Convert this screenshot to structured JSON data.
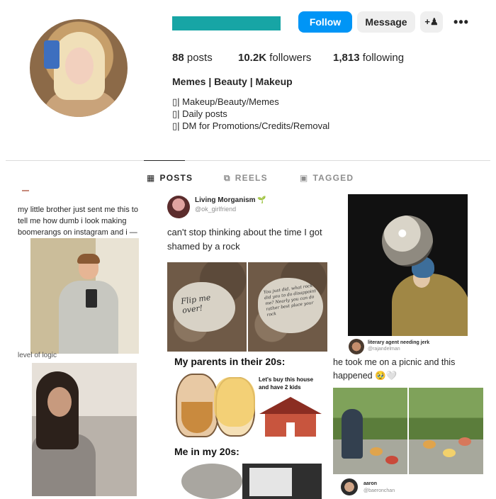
{
  "header": {
    "follow_label": "Follow",
    "message_label": "Message",
    "add_user_icon": "+ᴀ",
    "more_icon": "•••",
    "brand_color": "#0095f6",
    "redaction_color": "#17a5a5"
  },
  "stats": {
    "posts_count": "88",
    "posts_label": "posts",
    "followers_count": "10.2K",
    "followers_label": "followers",
    "following_count": "1,813",
    "following_label": "following"
  },
  "bio": {
    "name": "Memes | Beauty | Makeup",
    "lines": [
      "▯| Makeup/Beauty/Memes",
      "▯| Daily posts",
      "▯| DM for Promotions/Credits/Removal"
    ]
  },
  "tabs": {
    "posts": "POSTS",
    "reels": "REELS",
    "tagged": "TAGGED",
    "posts_icon": "▦",
    "reels_icon": "⧉",
    "tagged_icon": "▣"
  },
  "grid": {
    "post1": {
      "text": "my little brother just sent me this to tell me how dumb i look making boomerangs on instagram and i —",
      "caption": "level of logic"
    },
    "post2": {
      "account_name": "Living Morganism",
      "sprout_icon": "🌱",
      "account_handle": "@ok_girlfriend",
      "tweet": "can't stop thinking about the time I got shamed by a rock",
      "rock_left_text": "Flip me over!",
      "rock_right_text": "You just did, what rock did you to do disappoint me? Nearly you can do rather best place your rock",
      "heading_20s_parents": "My parents in their 20s:",
      "sub_text": "Let's buy this house and have 2 kids",
      "heading_20s_me": "Me in my 20s:"
    },
    "post3": {
      "account_name": "literary agent needing jerk",
      "account_handle": "@rajandelman",
      "tweet": "he took me on a picnic and this happened 🥹🤍",
      "reply_name": "aaron",
      "reply_handle": "@baeronchan"
    }
  }
}
